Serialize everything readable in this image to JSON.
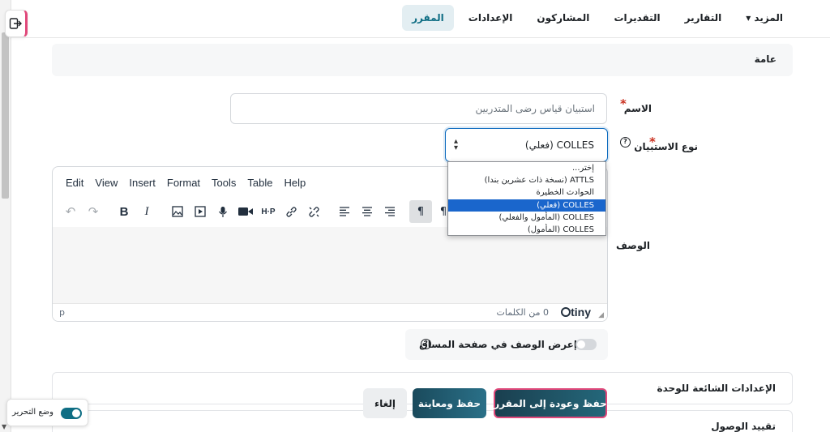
{
  "nav": {
    "tabs": [
      {
        "label": "المقرر",
        "active": true
      },
      {
        "label": "الإعدادات"
      },
      {
        "label": "المشاركون"
      },
      {
        "label": "التقديرات"
      },
      {
        "label": "التقارير"
      },
      {
        "label": "المزيد ▾"
      }
    ]
  },
  "general": {
    "title": "عامة"
  },
  "name": {
    "label": "الاسم",
    "value": "استبيان قياس رضى المتدربين"
  },
  "survey_type": {
    "label": "نوع الاستبيان",
    "selected": "COLLES (فعلي)",
    "options": [
      "إختر...",
      "ATTLS (نسخة ذات عشرين بندا)",
      "الحوادث الخطيرة",
      "COLLES (فعلي)",
      "COLLES (المأمول والفعلي)",
      "COLLES (المأمول)"
    ],
    "selected_index": 3
  },
  "editor": {
    "menu": [
      "Edit",
      "View",
      "Insert",
      "Format",
      "Tools",
      "Table",
      "Help"
    ],
    "path": "p",
    "word_count": "0 من الكلمات",
    "brand": "tiny"
  },
  "description": {
    "label": "الوصف"
  },
  "show_description": {
    "label": "إعرض الوصف في صفحة المساق",
    "enabled": false
  },
  "sections": {
    "common_module": "الإعدادات الشائعة للوحدة",
    "access_restrictions": "تقييد الوصول"
  },
  "buttons": {
    "save_return": "حفظ وعودة إلى المقرر",
    "save_display": "حفظ ومعاينة",
    "cancel": "إلغاء"
  },
  "edit_mode": {
    "label": "وضع التحرير",
    "enabled": true
  },
  "colors": {
    "accent": "#0f6e84",
    "primary_btn": "#1a3f4f",
    "focus": "#e0487a",
    "selected_option": "#1a66cc"
  }
}
